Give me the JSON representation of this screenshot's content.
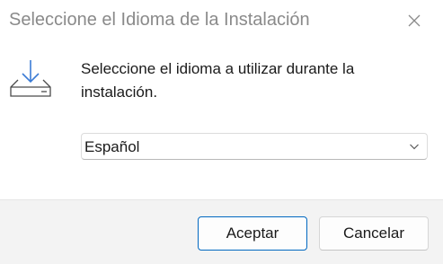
{
  "window": {
    "title": "Seleccione el Idioma de la Instalación",
    "close_icon": "close-icon"
  },
  "content": {
    "icon": "install-download-icon",
    "prompt": "Seleccione el idioma a utilizar durante la instalación.",
    "language_select": {
      "selected": "Español",
      "chevron_icon": "chevron-down-icon"
    }
  },
  "footer": {
    "ok_label": "Aceptar",
    "cancel_label": "Cancelar"
  },
  "colors": {
    "accent": "#0067c0",
    "footer_bg": "#f3f3f3",
    "title_text": "#8a8a8a"
  }
}
